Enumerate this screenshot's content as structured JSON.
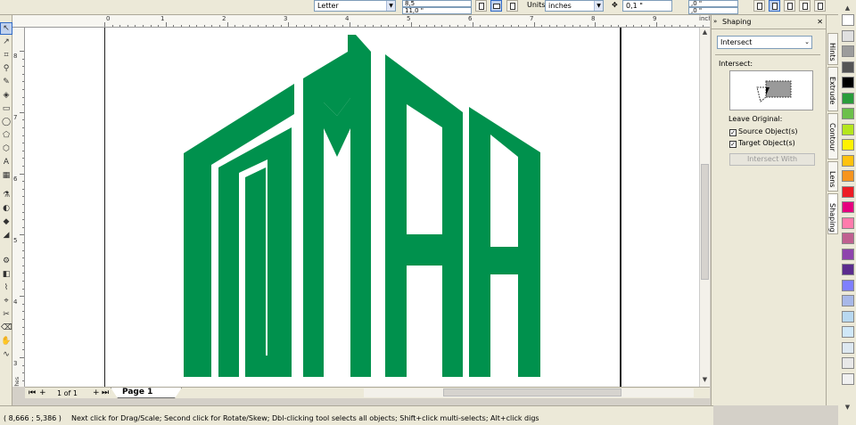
{
  "propbar": {
    "paper_size": "Letter",
    "page_width": "8,5",
    "page_height": "11,0 \"",
    "units_label": "Units:",
    "units_value": "inches",
    "nudge": "0,1 \"",
    "dup_x": ",0 \"",
    "dup_y": ",0 \""
  },
  "rulers": {
    "unit_label": "inches",
    "top": [
      "0",
      "1",
      "2",
      "3",
      "4",
      "5",
      "6",
      "7",
      "8",
      "9"
    ],
    "left": [
      "8",
      "7",
      "6",
      "5",
      "4",
      "3"
    ]
  },
  "pager": {
    "counter": "1 of 1",
    "current_page": "Page 1"
  },
  "status": {
    "coords": "( 8,666 ; 5,386 )",
    "message": "Next click for Drag/Scale; Second click for Rotate/Skew; Dbl-clicking tool selects all objects; Shift+click multi-selects; Alt+click digs"
  },
  "docker": {
    "title": "Shaping",
    "operation": "Intersect",
    "section_label": "Intersect:",
    "leave_original": "Leave Original:",
    "source_objects": "Source Object(s)",
    "target_objects": "Target Object(s)",
    "apply_button": "Intersect With"
  },
  "side_tabs": [
    "Hints",
    "Extrude",
    "Contour",
    "Lens",
    "Shaping"
  ],
  "logo_color": "#00914d",
  "palette": [
    "#ffffff",
    "#e0e0e0",
    "#9c9c9c",
    "#555555",
    "#000000",
    "#2a9d3a",
    "#6cc04a",
    "#b5e61d",
    "#fff200",
    "#ffc20e",
    "#f7941d",
    "#ed1c24",
    "#e6007e",
    "#ff7bac",
    "#c06090",
    "#8e44ad",
    "#5b2c8e",
    "#7f7fff",
    "#a8b8e8",
    "#b8d8f0",
    "#d0e8f8",
    "#dde8f0",
    "#e8e8e8",
    "#f0f0f0"
  ]
}
